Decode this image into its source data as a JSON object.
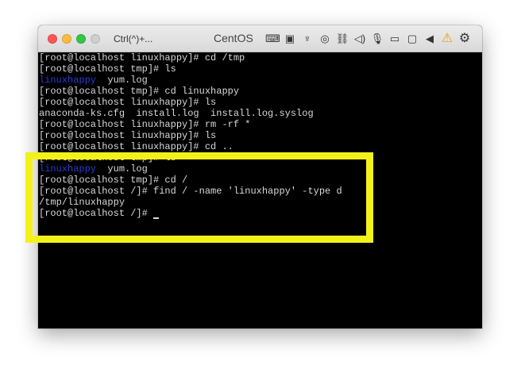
{
  "window": {
    "shortcut": "Ctrl(^)+...",
    "title": "CentOS",
    "toolbar_icons": [
      "keyboard-icon",
      "cpu-icon",
      "usb-icon",
      "camera-icon",
      "network-icon",
      "sound-icon",
      "microphone-icon",
      "display-icon",
      "video-icon",
      "arrow-left-icon",
      "warning-icon",
      "gear-icon"
    ]
  },
  "terminal": {
    "lines": [
      "[root@localhost linuxhappy]# cd /tmp",
      "[root@localhost tmp]# ls",
      {
        "dir": "linuxhappy",
        "rest": "  yum.log"
      },
      "[root@localhost tmp]# cd linuxhappy",
      "[root@localhost linuxhappy]# ls",
      "anaconda-ks.cfg  install.log  install.log.syslog",
      "[root@localhost linuxhappy]# rm -rf *",
      "[root@localhost linuxhappy]# ls",
      "[root@localhost linuxhappy]# cd ..",
      "[root@localhost tmp]# ls",
      {
        "dir": "linuxhappy",
        "rest": "  yum.log"
      },
      "[root@localhost tmp]# cd /",
      "[root@localhost /]# find / -name 'linuxhappy' -type d",
      "/tmp/linuxhappy",
      {
        "prompt": "[root@localhost /]# "
      }
    ]
  },
  "colors": {
    "highlight": "#f3f11a",
    "dir": "#2a3bd8",
    "text": "#d8d8d8",
    "background": "#000000"
  }
}
